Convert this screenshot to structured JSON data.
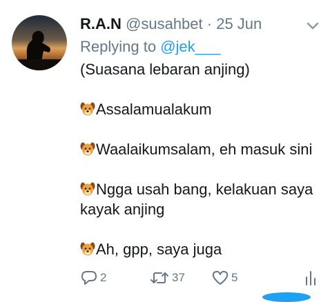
{
  "tweet": {
    "author_name": "R.A.N",
    "handle": "@susahbet",
    "separator": "·",
    "date": "25 Jun",
    "replying_prefix": "Replying to",
    "replying_mention": "@jek___",
    "lines": [
      "(Suasana lebaran anjing)",
      "Assalamualakum",
      "Waalaikumsalam, eh masuk sini",
      "Ngga usah bang, kelakuan saya",
      "kayak anjing",
      "Ah, gpp, saya juga"
    ],
    "dialogue_icon": "dog-face-emoji"
  },
  "actions": {
    "reply_count": "2",
    "retweet_count": "37",
    "like_count": "5",
    "icons": [
      "reply-icon",
      "retweet-icon",
      "like-icon",
      "analytics-icon"
    ]
  },
  "colors": {
    "text": "#14171a",
    "muted": "#657786",
    "link": "#1da1f2",
    "background": "#ffffff"
  }
}
